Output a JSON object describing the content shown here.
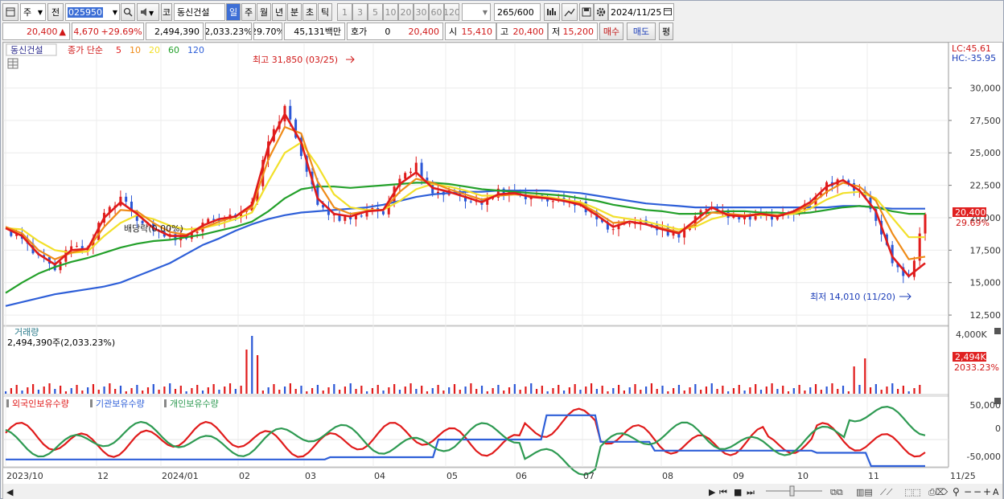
{
  "toolbar": {
    "market_type": "주",
    "prev_label": "전",
    "stock_code": "025950",
    "stock_type": "코",
    "stock_name": "동신건설",
    "periods": [
      "일",
      "주",
      "월",
      "년",
      "분",
      "초",
      "틱"
    ],
    "selected_period": "일",
    "intervals": [
      "1",
      "3",
      "5",
      "10",
      "20",
      "30",
      "60",
      "120"
    ],
    "count": "265",
    "count_total": "/600",
    "date": "2024/11/25"
  },
  "quote": {
    "price": "20,400",
    "change": "4,670",
    "change_pct": "+29.69%",
    "volume": "2,494,390",
    "volume_ratio": "2,033.23%",
    "turnover": "29.70%",
    "amount": "45,131백만",
    "hoga_label": "호가",
    "hoga_value": "0",
    "hoga_price": "20,400",
    "open_label": "시",
    "open": "15,410",
    "high_label": "고",
    "high": "20,400",
    "low_label": "저",
    "low": "15,200",
    "buy_label": "매수",
    "sell_label": "매도",
    "avg_label": "평"
  },
  "price_panel": {
    "stock_label": "동신건설",
    "ma_label": "종가 단순",
    "ma_periods": [
      "5",
      "10",
      "20",
      "60",
      "120"
    ],
    "ma_colors": [
      "#e01b1b",
      "#ef8b18",
      "#f2e02a",
      "#23a02a",
      "#2e5fd8"
    ],
    "lc_label": "LC:45.61",
    "hc_label": "HC:-35.95",
    "high_annotation": "최고 31,850 (03/25)",
    "low_annotation": "최저 14,010 (11/20)",
    "dividend_annotation": "배당락(0.00%)",
    "current_price_tag": "20,400",
    "current_pct_tag": "29.69%"
  },
  "volume_panel": {
    "title": "거래량",
    "subtitle": "2,494,390주(2,033.23%)",
    "current_volume_tag": "2,494K",
    "current_pct_tag": "2033.23%"
  },
  "holding_panel": {
    "legend": [
      "외국인보유수량",
      "기관보유수량",
      "개인보유수량"
    ],
    "colors": [
      "#e01b1b",
      "#2e5fd8",
      "#2e9a52"
    ]
  },
  "x_labels": [
    "2023/10",
    "12",
    "2024/01",
    "02",
    "03",
    "04",
    "05",
    "06",
    "07",
    "08",
    "09",
    "10",
    "11",
    "11/25"
  ],
  "chart_data": {
    "type": "candlestick",
    "price_axis": {
      "range": [
        12500,
        31850
      ],
      "ticks": [
        "30,000",
        "27,500",
        "25,000",
        "22,500",
        "20,000",
        "17,500",
        "15,000",
        "12,500"
      ]
    },
    "volume_axis": {
      "ticks": [
        "4,000K",
        "0"
      ]
    },
    "holding_axis": {
      "ticks": [
        "50,000",
        "0",
        "-50,000"
      ]
    },
    "series": [
      {
        "name": "동신건설",
        "values": [
          19000,
          18500,
          17000,
          16200,
          17800,
          17500,
          20500,
          21500,
          20000,
          19000,
          18500,
          18500,
          19500,
          20000,
          20000,
          21000,
          26000,
          28500,
          25000,
          21000,
          20000,
          20000,
          20500,
          20500,
          23000,
          24000,
          22000,
          22000,
          21500,
          21000,
          22000,
          22000,
          21500,
          21500,
          21200,
          21000,
          20000,
          19000,
          19800,
          19500,
          19000,
          18600,
          20000,
          21000,
          20000,
          20000,
          20300,
          20000,
          20500,
          21000,
          22500,
          23000,
          22000,
          20000,
          16500,
          15200,
          20400
        ]
      },
      {
        "name": "5",
        "values": [
          19200,
          18600,
          17200,
          16400,
          17500,
          17600,
          20000,
          21200,
          20300,
          19200,
          18600,
          18600,
          19400,
          19900,
          20100,
          21000,
          25500,
          28000,
          25800,
          21500,
          20300,
          20100,
          20500,
          20600,
          22600,
          23500,
          22300,
          22000,
          21600,
          21200,
          21800,
          21900,
          21600,
          21500,
          21300,
          21000,
          20200,
          19300,
          19700,
          19500,
          19100,
          18800,
          19800,
          20800,
          20200,
          20100,
          20300,
          20100,
          20500,
          21200,
          22400,
          22900,
          22100,
          20500,
          17000,
          15500,
          16500
        ]
      },
      {
        "name": "10",
        "values": [
          19300,
          18800,
          17500,
          16800,
          17300,
          17600,
          19300,
          20600,
          20500,
          19600,
          18900,
          18700,
          19200,
          19700,
          20100,
          20800,
          24500,
          27000,
          26500,
          22800,
          20800,
          20300,
          20500,
          20600,
          22000,
          23000,
          22700,
          22200,
          21800,
          21400,
          21700,
          21800,
          21700,
          21500,
          21300,
          21100,
          20400,
          19600,
          19700,
          19500,
          19200,
          18900,
          19500,
          20400,
          20300,
          20200,
          20300,
          20200,
          20400,
          21000,
          22000,
          22700,
          22400,
          21300,
          18800,
          16800,
          17000
        ]
      },
      {
        "name": "20",
        "values": [
          19200,
          19100,
          18200,
          17500,
          17300,
          17400,
          18600,
          19600,
          20200,
          19900,
          19400,
          19100,
          19200,
          19500,
          19900,
          20400,
          22800,
          25000,
          25800,
          24000,
          21800,
          20800,
          20600,
          20600,
          21300,
          22200,
          22600,
          22400,
          22100,
          21700,
          21700,
          21800,
          21700,
          21600,
          21400,
          21200,
          20700,
          20100,
          19900,
          19700,
          19400,
          19100,
          19300,
          19900,
          20200,
          20200,
          20200,
          20200,
          20300,
          20700,
          21400,
          21900,
          22000,
          21500,
          20000,
          18500,
          18500
        ]
      },
      {
        "name": "60",
        "values": [
          14200,
          15000,
          15700,
          16200,
          16600,
          16900,
          17300,
          17700,
          18000,
          18200,
          18300,
          18500,
          18700,
          19000,
          19300,
          19700,
          20500,
          21500,
          22200,
          22400,
          22400,
          22300,
          22400,
          22500,
          22600,
          22700,
          22700,
          22600,
          22400,
          22200,
          22100,
          22000,
          21900,
          21800,
          21700,
          21500,
          21300,
          21000,
          20800,
          20600,
          20500,
          20300,
          20300,
          20400,
          20500,
          20500,
          20400,
          20400,
          20300,
          20400,
          20600,
          20800,
          20900,
          20800,
          20500,
          20300,
          20300
        ]
      },
      {
        "name": "120",
        "values": [
          13200,
          13500,
          13800,
          14100,
          14300,
          14500,
          14700,
          15000,
          15500,
          16000,
          16500,
          17200,
          17900,
          18400,
          19000,
          19500,
          19900,
          20200,
          20400,
          20500,
          20600,
          20700,
          20800,
          21000,
          21300,
          21600,
          21800,
          21900,
          22000,
          22000,
          22100,
          22100,
          22100,
          22100,
          22000,
          21900,
          21700,
          21500,
          21300,
          21100,
          21000,
          20900,
          20800,
          20800,
          20800,
          20800,
          20800,
          20800,
          20800,
          20800,
          20800,
          20900,
          20900,
          20800,
          20700,
          20700,
          20700
        ]
      }
    ]
  }
}
